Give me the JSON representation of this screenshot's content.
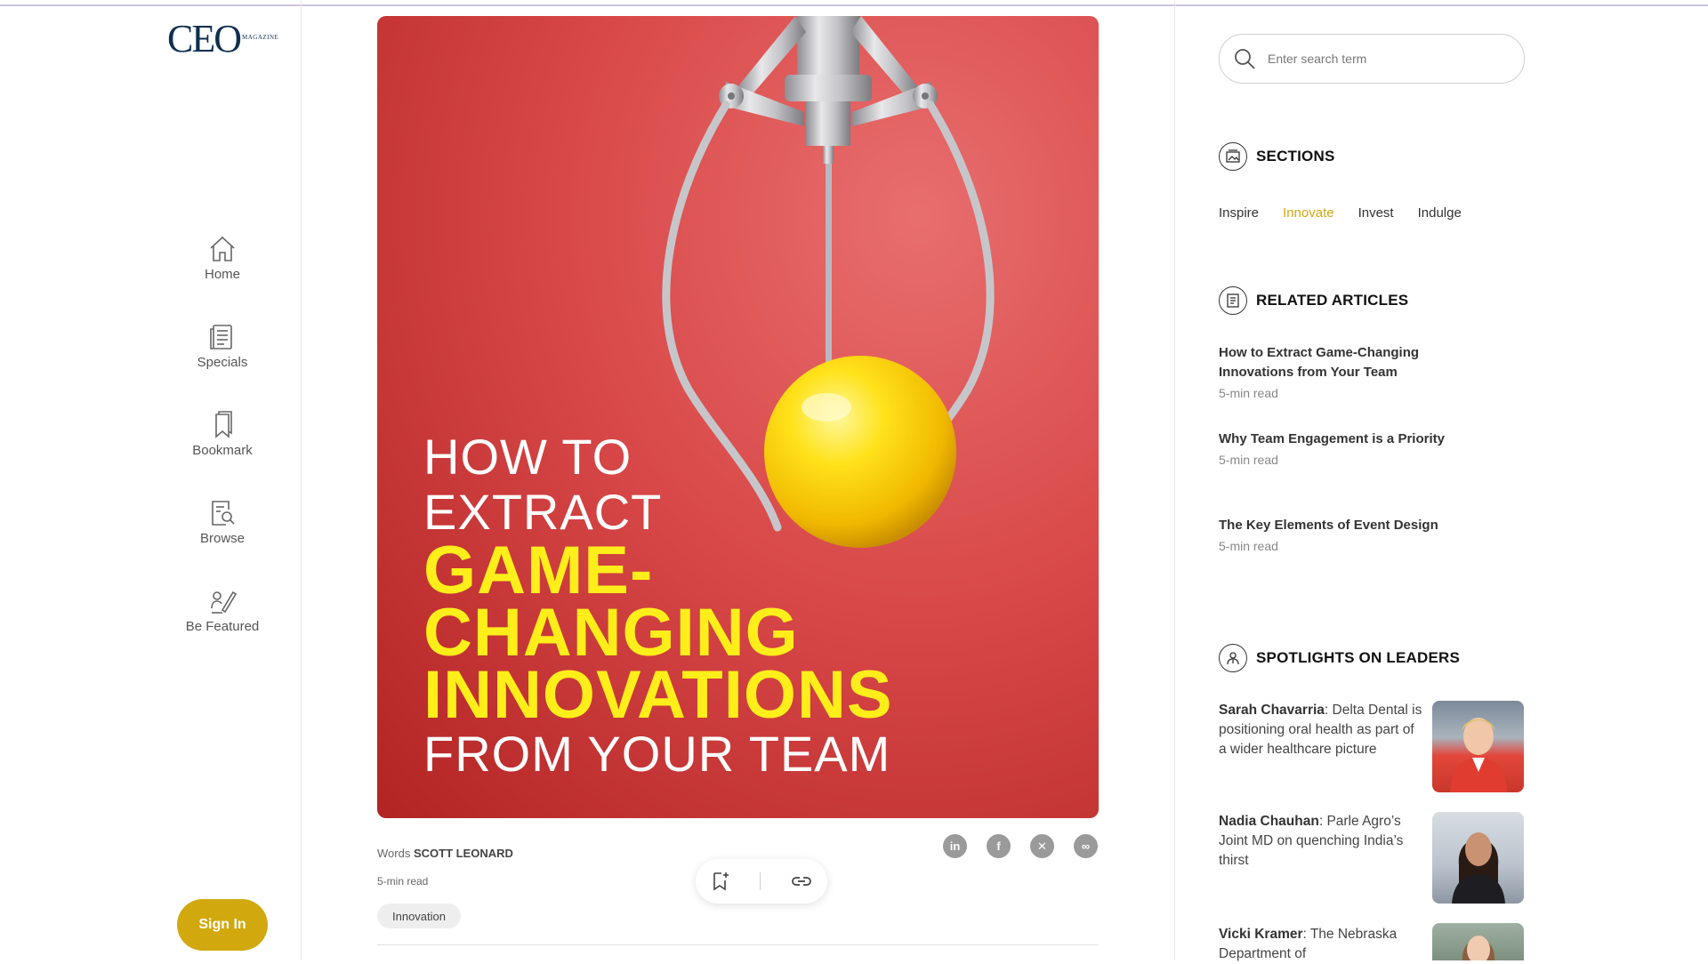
{
  "brand": {
    "logo_main": "CEO",
    "logo_sub": "MAGAZINE"
  },
  "nav": [
    {
      "label": "Home",
      "icon": "home-icon"
    },
    {
      "label": "Specials",
      "icon": "newspaper-icon"
    },
    {
      "label": "Bookmark",
      "icon": "bookmark-icon"
    },
    {
      "label": "Browse",
      "icon": "browse-icon"
    },
    {
      "label": "Be Featured",
      "icon": "pen-icon"
    }
  ],
  "signin_label": "Sign In",
  "hero": {
    "line1": "HOW TO",
    "line2": "EXTRACT",
    "line3": "GAME-",
    "line4": "CHANGING",
    "line5": "INNOVATIONS",
    "line6": "FROM YOUR TEAM"
  },
  "article": {
    "words_prefix": "Words",
    "author": "SCOTT LEONARD",
    "read_time": "5-min read",
    "tag": "Innovation"
  },
  "share_icons": [
    "linkedin-icon",
    "facebook-icon",
    "x-icon",
    "link-share-icon"
  ],
  "search": {
    "placeholder": "Enter search term"
  },
  "sections": {
    "heading": "SECTIONS",
    "items": [
      "Inspire",
      "Innovate",
      "Invest",
      "Indulge"
    ],
    "active": "Innovate"
  },
  "related": {
    "heading": "RELATED ARTICLES",
    "items": [
      {
        "title": "How to Extract Game-Changing Innovations from Your Team",
        "read": "5-min read"
      },
      {
        "title": "Why Team Engagement is a Priority",
        "read": "5-min read"
      },
      {
        "title": "The Key Elements of Event Design",
        "read": "5-min read"
      }
    ]
  },
  "spotlights": {
    "heading": "SPOTLIGHTS ON LEADERS",
    "items": [
      {
        "name": "Sarah Chavarria",
        "text": ": Delta Dental is positioning oral health as part of a wider healthcare picture"
      },
      {
        "name": "Nadia Chauhan",
        "text": ": Parle Agro’s Joint MD on quenching India’s thirst"
      },
      {
        "name": "Vicki Kramer",
        "text": ": The Nebraska Department of"
      }
    ]
  },
  "colors": {
    "accent": "#d1a90f",
    "hero_red": "#d94949",
    "hero_yellow": "#ffee1a",
    "logo_navy": "#0f2f4f"
  }
}
